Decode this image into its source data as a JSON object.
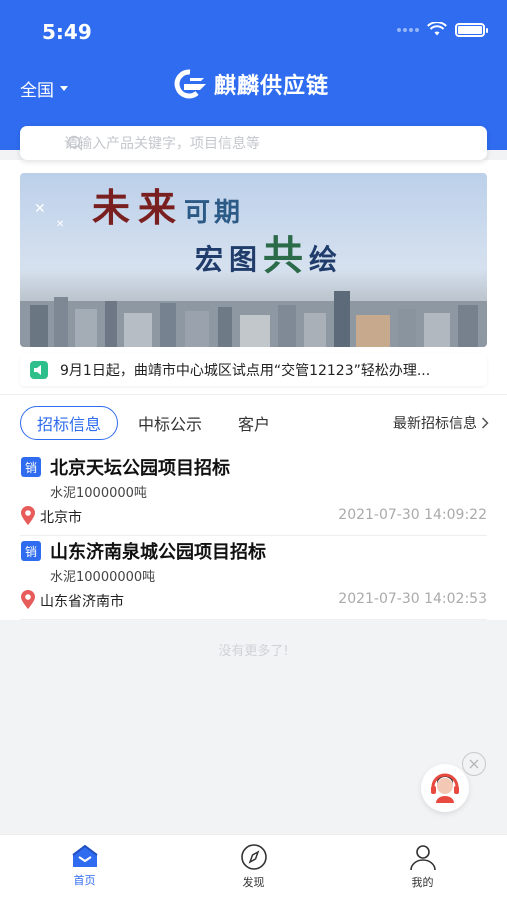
{
  "status_bar": {
    "time": "5:49"
  },
  "header": {
    "region": "全国",
    "brand_title": "麒麟供应链"
  },
  "search": {
    "placeholder": "请输入产品关键字，项目信息等"
  },
  "banner": {
    "line1_main": "未来",
    "line1_sub": "可期",
    "line2_a": "宏图",
    "line2_big": "共",
    "line2_b": "绘"
  },
  "notice": {
    "text": "9月1日起，曲靖市中心城区试点用“交管12123”轻松办理..."
  },
  "tabs": [
    {
      "label": "招标信息",
      "active": true
    },
    {
      "label": "中标公示",
      "active": false
    },
    {
      "label": "客户",
      "active": false
    }
  ],
  "latest_link": "最新招标信息",
  "listings": [
    {
      "tag": "销",
      "title": "北京天坛公园项目招标",
      "spec": "水泥1000000吨",
      "location": "北京市",
      "time": "2021-07-30 14:09:22"
    },
    {
      "tag": "销",
      "title": "山东济南泉城公园项目招标",
      "spec": "水泥10000000吨",
      "location": "山东省济南市",
      "time": "2021-07-30 14:02:53"
    }
  ],
  "no_more": "没有更多了!",
  "tabbar": [
    {
      "label": "首页",
      "icon": "home-icon",
      "active": true
    },
    {
      "label": "发现",
      "icon": "compass-icon",
      "active": false
    },
    {
      "label": "我的",
      "icon": "user-icon",
      "active": false
    }
  ],
  "colors": {
    "primary": "#2f6cf0",
    "notice_icon": "#2fbf8a",
    "location_pin": "#e85b5b"
  }
}
